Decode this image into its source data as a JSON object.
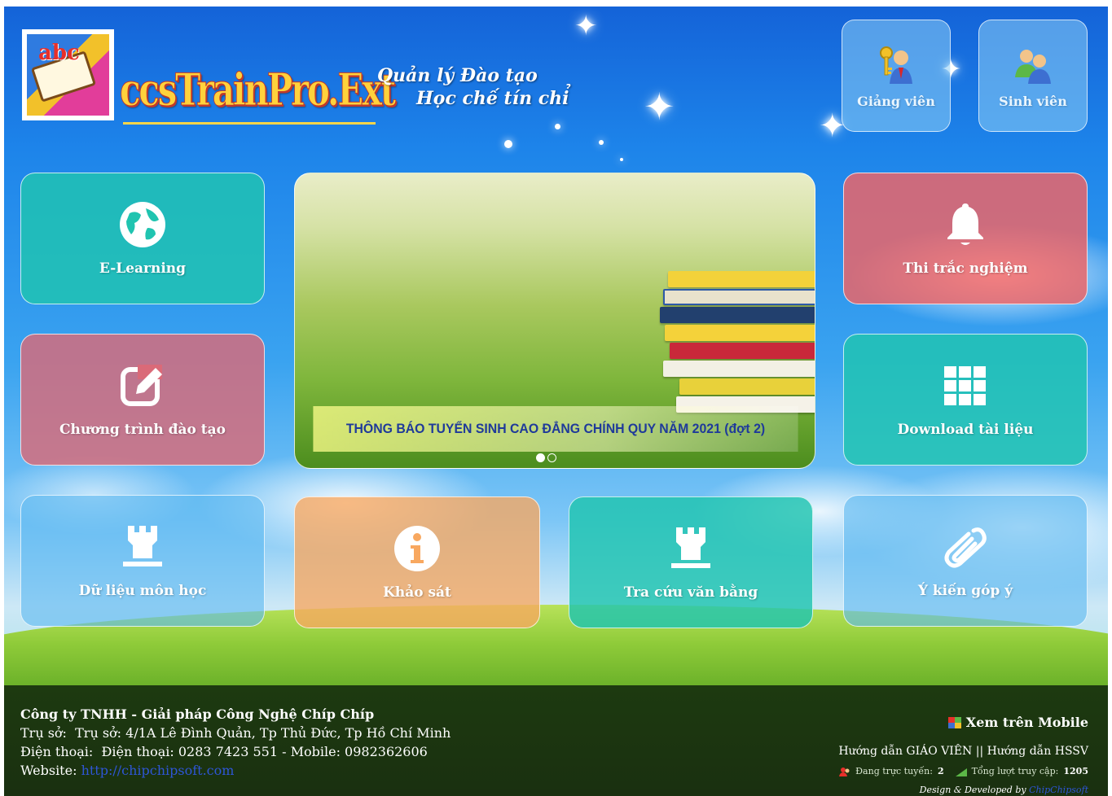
{
  "header": {
    "brand": "ccsTrainPro.Ext",
    "tagline_line1": "Quản lý Đào tạo",
    "tagline_line2": "Học chế tín chỉ",
    "logo_text": "abc"
  },
  "top_buttons": [
    {
      "label": "Giảng viên",
      "icon": "teacher-icon"
    },
    {
      "label": "Sinh viên",
      "icon": "students-icon"
    }
  ],
  "tiles": {
    "elearning": "E-Learning",
    "curriculum": "Chương trình đào tạo",
    "subject_data": "Dữ liệu môn học",
    "survey": "Khảo sát",
    "diploma_lookup": "Tra cứu văn bằng",
    "quiz": "Thi trắc nghiệm",
    "download": "Download tài liệu",
    "feedback": "Ý kiến góp ý"
  },
  "slider": {
    "caption": "THÔNG BÁO TUYỂN SINH CAO ĐẲNG CHÍNH QUY NĂM 2021 (đợt 2)",
    "slide_count": 2,
    "active_slide": 1
  },
  "footer": {
    "company": "Công ty TNHH - Giải pháp Công Nghệ Chíp Chíp",
    "address_label": "Trụ sở:",
    "address": "Trụ sở: 4/1A Lê Đình Quản, Tp Thủ Đức, Tp Hồ Chí Minh",
    "phone_label": "Điện thoại:",
    "phone": "Điện thoại: 0283 7423 551 - Mobile: 0982362606",
    "website_label": "Website:",
    "website": "http://chipchipsoft.com",
    "mobile_link": "Xem trên Mobile",
    "guide_teacher": "Hướng dẫn GIÁO VIÊN",
    "guide_separator": "||",
    "guide_student": "Hướng dẫn HSSV",
    "online_label": "Đang trực tuyến:",
    "online_count": "2",
    "total_label": "Tổng lượt truy cập:",
    "total_count": "1205",
    "credit_prefix": "Design & Developed by",
    "credit_name": "ChipChipsoft"
  },
  "colors": {
    "teal": "#20c4b0",
    "rose": "#da6a78",
    "salmon": "#f26464",
    "orange": "#f8a860",
    "sky": "#60baf0",
    "footer_bg": "#1d3a10"
  }
}
